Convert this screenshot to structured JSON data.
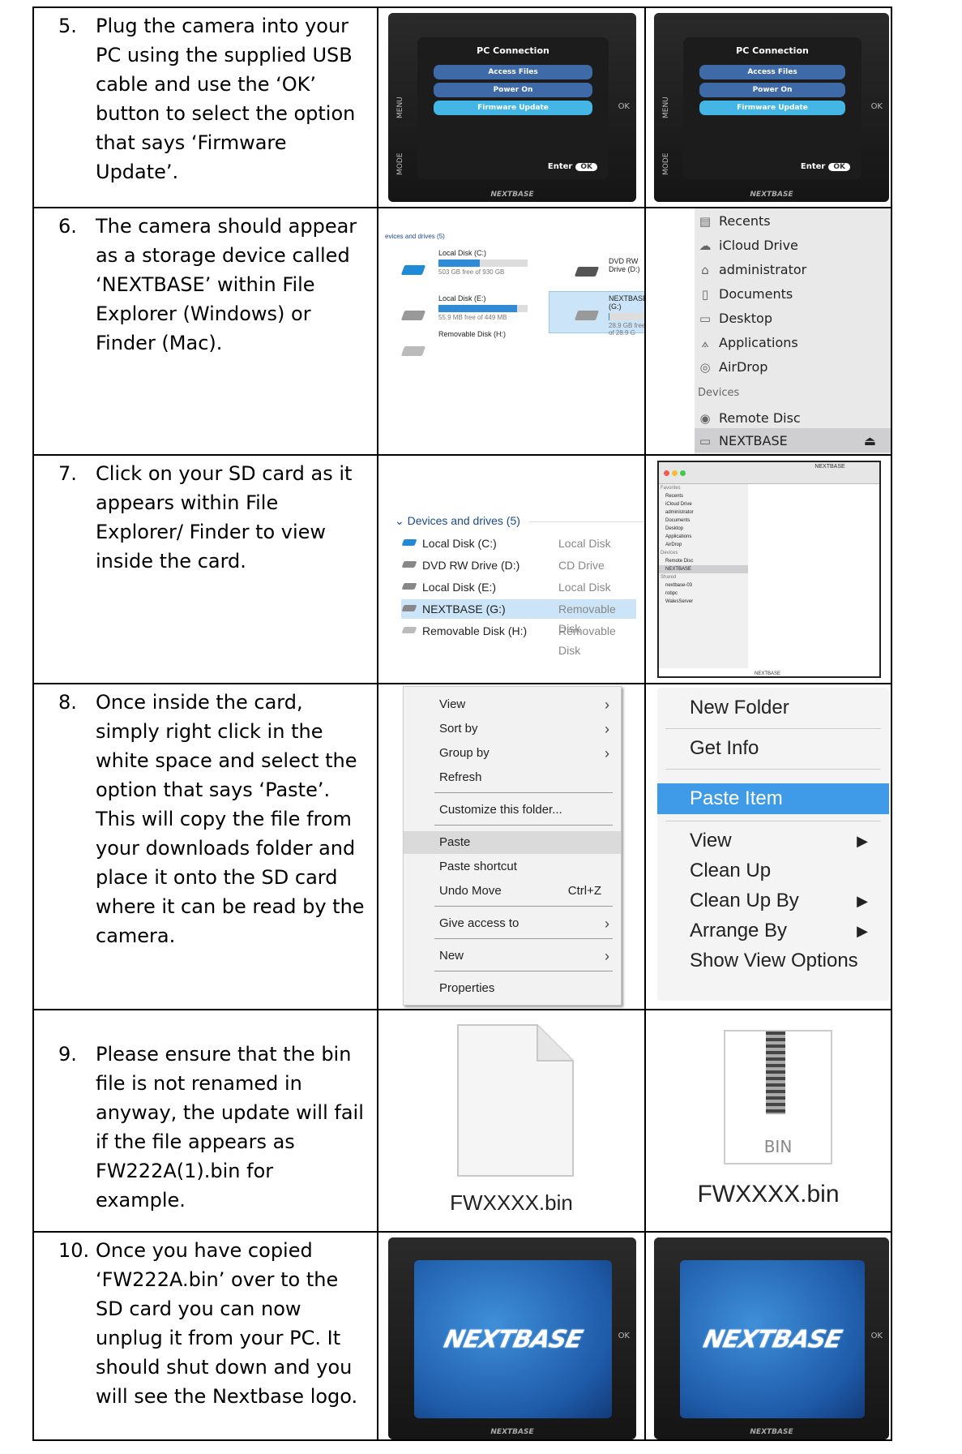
{
  "steps": [
    {
      "number": "5.",
      "text": "Plug the camera into your PC using the supplied USB cable and use the ‘OK’ button to select the option that says ‘Firmware Update’."
    },
    {
      "number": "6.",
      "text": "The camera should appear as a storage device called ‘NEXTBASE’ within File Explorer (Windows) or Finder (Mac)."
    },
    {
      "number": "7.",
      "text": "Click on your SD card as it appears within File Explorer/ Finder to view inside the card."
    },
    {
      "number": "8.",
      "text": "Once inside the card, simply right click in the white space and select the option that says ‘Paste’. This will copy the file from your downloads folder and place it onto the SD card where it can be read by the camera."
    },
    {
      "number": "9.",
      "text": "Please ensure that the bin file is not renamed in anyway, the update will fail if the file appears as FW222A(1).bin for example."
    },
    {
      "number": "10.",
      "text": "Once you have copied ‘FW222A.bin’ over to the SD card you can now unplug it from your PC. It should shut down and you will see the Nextbase logo."
    }
  ],
  "camera_menu": {
    "title": "PC Connection",
    "items": [
      "Access Files",
      "Power On",
      "Firmware Update"
    ],
    "enter": "Enter",
    "ok": "OK",
    "menu_label": "MENU",
    "mode_label": "MODE",
    "ok_label": "OK",
    "brand": "NEXTBASE"
  },
  "win_drives": {
    "header": "evices and drives (5)",
    "drives": [
      {
        "name": "Local Disk (C:)",
        "free": "503 GB free of 930 GB",
        "fill": 0.46
      },
      {
        "name": "DVD RW Drive (D:)",
        "free": "",
        "fill": 0
      },
      {
        "name": "Local Disk (E:)",
        "free": "55.9 MB free of 449 MB",
        "fill": 0.88
      },
      {
        "name": "NEXTBASE (G:)",
        "free": "28.9 GB free of 28.9 G",
        "fill": 0.01
      },
      {
        "name": "Removable Disk (H:)",
        "free": "",
        "fill": 0
      }
    ]
  },
  "mac_sidebar": {
    "items": [
      "Recents",
      "iCloud Drive",
      "administrator",
      "Documents",
      "Desktop",
      "Applications",
      "AirDrop"
    ],
    "devices_label": "Devices",
    "devices": [
      "Remote Disc",
      "NEXTBASE"
    ],
    "eject": "⏏"
  },
  "devices_list": {
    "header": "Devices and drives (5)",
    "rows": [
      {
        "name": "Local Disk (C:)",
        "type": "Local Disk"
      },
      {
        "name": "DVD RW Drive (D:)",
        "type": "CD Drive"
      },
      {
        "name": "Local Disk (E:)",
        "type": "Local Disk"
      },
      {
        "name": "NEXTBASE (G:)",
        "type": "Removable Disk"
      },
      {
        "name": "Removable Disk (H:)",
        "type": "Removable Disk"
      }
    ]
  },
  "finder": {
    "title": "NEXTBASE",
    "favorites_label": "Favorites",
    "favorites": [
      "Recents",
      "iCloud Drive",
      "administrator",
      "Documents",
      "Desktop",
      "Applications",
      "AirDrop"
    ],
    "devices_label": "Devices",
    "devices": [
      "Remote Disc",
      "NEXTBASE"
    ],
    "shared_label": "Shared",
    "shared": [
      "nextbase-03",
      "robpc",
      "WalesServer"
    ],
    "footer": "NEXTBASE"
  },
  "win_context_menu": {
    "items": [
      {
        "label": "View",
        "arrow": "›"
      },
      {
        "label": "Sort by",
        "arrow": "›"
      },
      {
        "label": "Group by",
        "arrow": "›"
      },
      {
        "label": "Refresh"
      },
      {
        "label": "Customize this folder..."
      },
      {
        "label": "Paste"
      },
      {
        "label": "Paste shortcut"
      },
      {
        "label": "Undo Move",
        "shortcut": "Ctrl+Z"
      },
      {
        "label": "Give access to",
        "arrow": "›"
      },
      {
        "label": "New",
        "arrow": "›"
      },
      {
        "label": "Properties"
      }
    ]
  },
  "mac_context_menu": {
    "items": [
      {
        "label": "New Folder"
      },
      {
        "label": "Get Info"
      },
      {
        "label": "Paste Item"
      },
      {
        "label": "View",
        "arrow": "▶"
      },
      {
        "label": "Clean Up"
      },
      {
        "label": "Clean Up By",
        "arrow": "▶"
      },
      {
        "label": "Arrange By",
        "arrow": "▶"
      },
      {
        "label": "Show View Options"
      }
    ]
  },
  "files": {
    "win_name": "FWXXXX.bin",
    "mac_name": "FWXXXX.bin",
    "mac_badge": "BIN"
  },
  "logo": {
    "text": "NEXTBASE",
    "ok": "OK",
    "brand": "NEXTBASE"
  }
}
